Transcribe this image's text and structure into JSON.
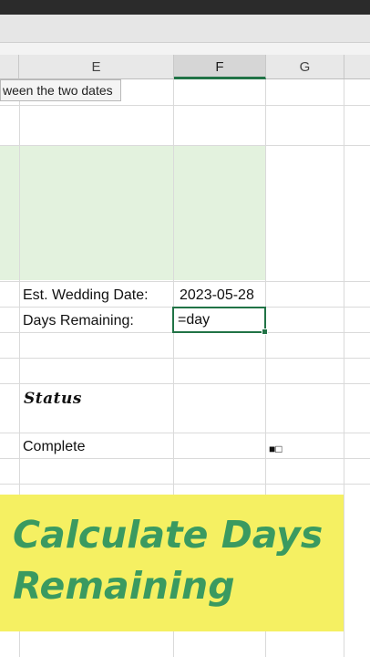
{
  "columns": [
    {
      "label": "E"
    },
    {
      "label": "F"
    },
    {
      "label": "G"
    }
  ],
  "tooltip": "ween the two dates",
  "cells": {
    "wedding_label": "Est. Wedding Date:",
    "wedding_value": "2023-05-28",
    "days_label": "Days Remaining:",
    "days_formula": "=day",
    "status_heading": "Status",
    "complete_label": "Complete",
    "checkbox_glyphs": "■□"
  },
  "banner": {
    "line1": "Calculate Days",
    "line2": "Remaining"
  },
  "colors": {
    "excel_green": "#217346",
    "banner_yellow": "#f5f062",
    "banner_text": "#3a9a60",
    "block_green": "#e3f2de"
  }
}
